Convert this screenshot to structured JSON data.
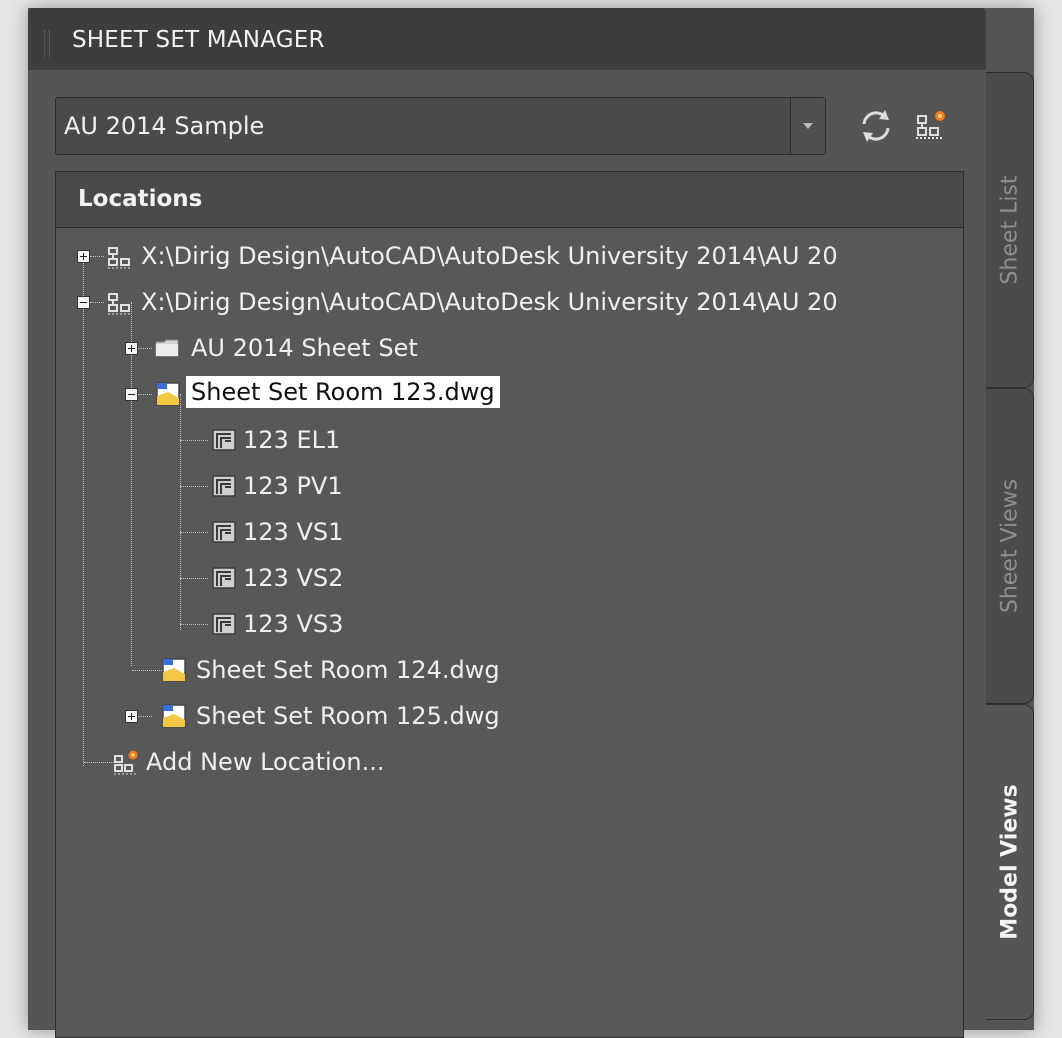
{
  "panel": {
    "title": "SHEET SET MANAGER"
  },
  "combo": {
    "value": "AU 2014 Sample"
  },
  "toolbar": {
    "refresh_icon": "refresh-icon",
    "new_location_icon": "add-location-icon"
  },
  "tree": {
    "header": "Locations",
    "rows": [
      {
        "label": "X:\\Dirig Design\\AutoCAD\\AutoDesk University 2014\\AU 20",
        "icon": "location-icon",
        "expander": "plus"
      },
      {
        "label": "X:\\Dirig Design\\AutoCAD\\AutoDesk University 2014\\AU 20",
        "icon": "location-icon",
        "expander": "minus"
      },
      {
        "label": "AU 2014 Sheet Set",
        "icon": "folder-icon",
        "expander": "plus"
      },
      {
        "label": "Sheet Set Room 123.dwg",
        "icon": "drawing-file-icon",
        "expander": "minus",
        "selected": true
      },
      {
        "label": "123 EL1",
        "icon": "model-view-icon"
      },
      {
        "label": "123 PV1",
        "icon": "model-view-icon"
      },
      {
        "label": "123 VS1",
        "icon": "model-view-icon"
      },
      {
        "label": "123 VS2",
        "icon": "model-view-icon"
      },
      {
        "label": "123 VS3",
        "icon": "model-view-icon"
      },
      {
        "label": "Sheet Set Room 124.dwg",
        "icon": "drawing-file-icon"
      },
      {
        "label": "Sheet Set Room 125.dwg",
        "icon": "drawing-file-icon",
        "expander": "plus"
      },
      {
        "label": "Add New Location...",
        "icon": "add-location-icon"
      }
    ]
  },
  "tabs": [
    {
      "label": "Sheet List",
      "active": false
    },
    {
      "label": "Sheet Views",
      "active": false
    },
    {
      "label": "Model Views",
      "active": true
    }
  ],
  "colors": {
    "panel_bg": "#555555",
    "title_bg": "#3d3d3d",
    "folder_yellow": "#f2c744",
    "accent_orange": "#f07a1a"
  }
}
